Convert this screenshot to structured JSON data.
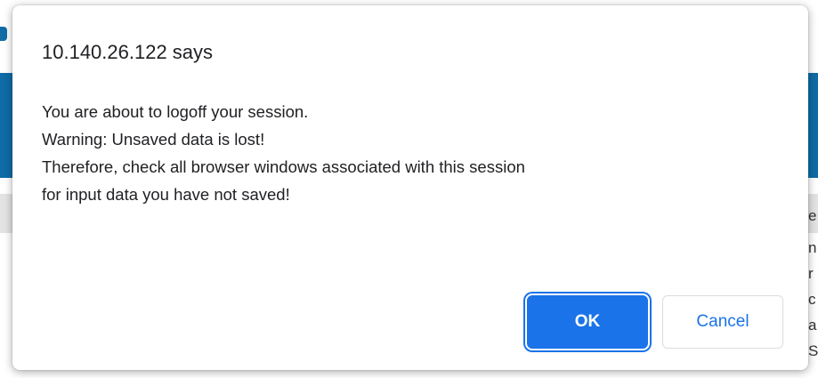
{
  "background": {
    "fragments": [
      "e",
      "n",
      "r",
      "c",
      "a",
      "S"
    ]
  },
  "dialog": {
    "title": "10.140.26.122 says",
    "message_lines": [
      "You are about to logoff your session.",
      "Warning: Unsaved data is lost!",
      "Therefore, check all browser windows associated with this session",
      "for input data you have not saved!"
    ],
    "ok_label": "OK",
    "cancel_label": "Cancel"
  },
  "colors": {
    "accent": "#1a73e8",
    "background_band": "#0f6ca6"
  }
}
